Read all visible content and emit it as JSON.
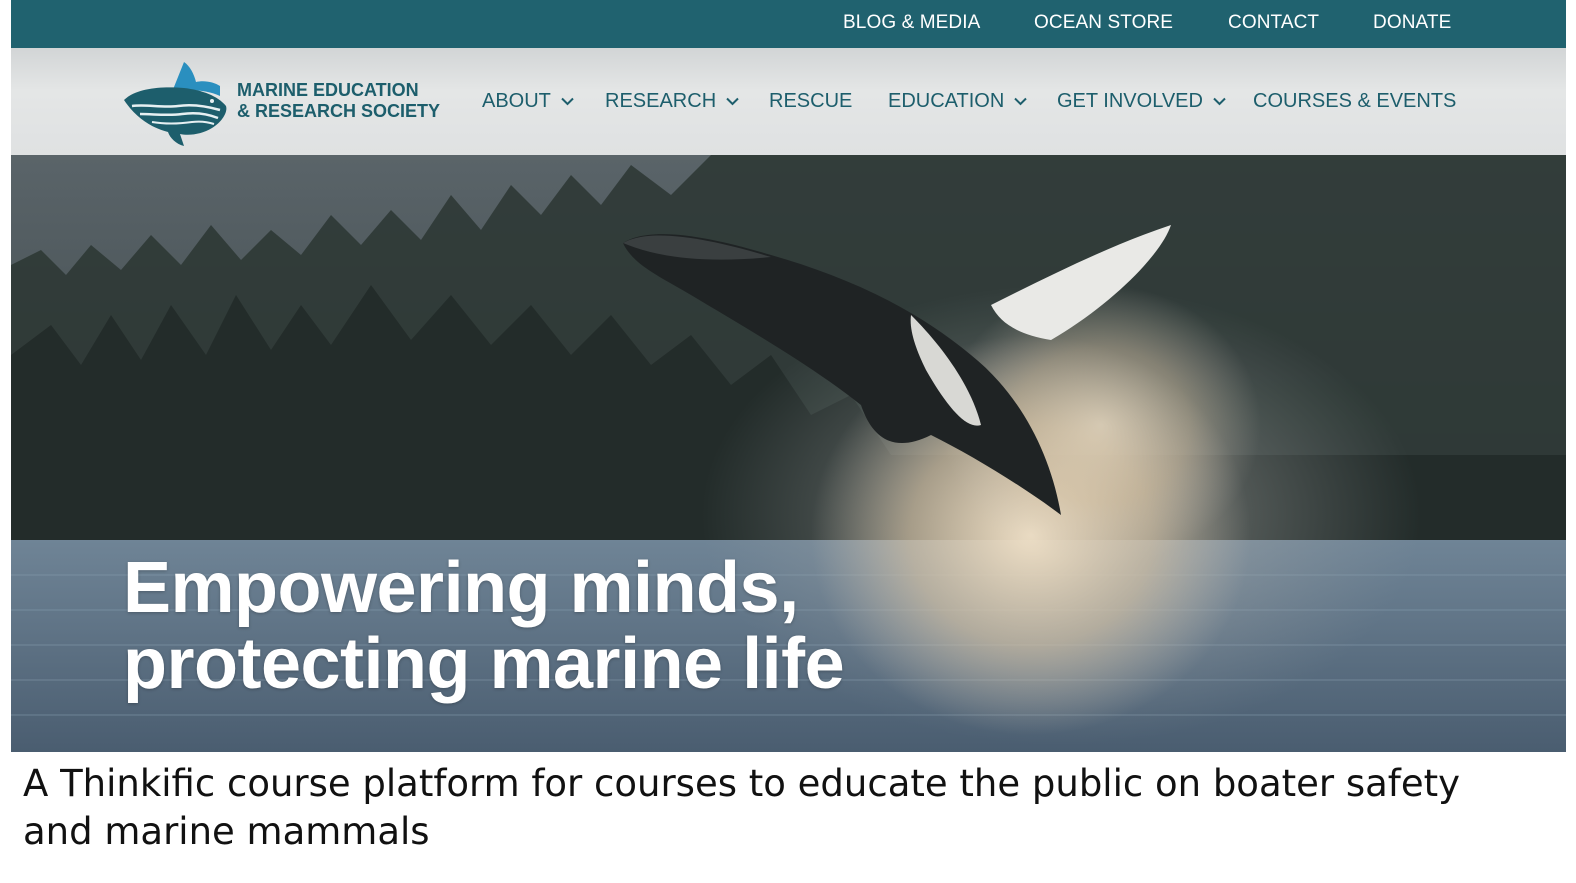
{
  "topbar": {
    "links": [
      "BLOG & MEDIA",
      "OCEAN STORE",
      "CONTACT",
      "DONATE"
    ]
  },
  "header": {
    "brand_line1": "MARINE EDUCATION",
    "brand_line2": "& RESEARCH SOCIETY",
    "logo_icon": "whale-logo-icon",
    "nav": [
      {
        "label": "ABOUT",
        "dropdown": true
      },
      {
        "label": "RESEARCH",
        "dropdown": true
      },
      {
        "label": "RESCUE",
        "dropdown": false
      },
      {
        "label": "EDUCATION",
        "dropdown": true
      },
      {
        "label": "GET INVOLVED",
        "dropdown": true
      },
      {
        "label": "COURSES & EVENTS",
        "dropdown": false
      }
    ]
  },
  "hero": {
    "headline_line1": "Empowering minds,",
    "headline_line2": "protecting marine life",
    "image_subject": "humpback-whale-breach-photo"
  },
  "caption": "A Thinkific course platform for courses to educate the public on boater safety and marine mammals",
  "colors": {
    "brand": "#1d5e6c",
    "topbar": "#20626f",
    "accent": "#2a8fbf"
  }
}
